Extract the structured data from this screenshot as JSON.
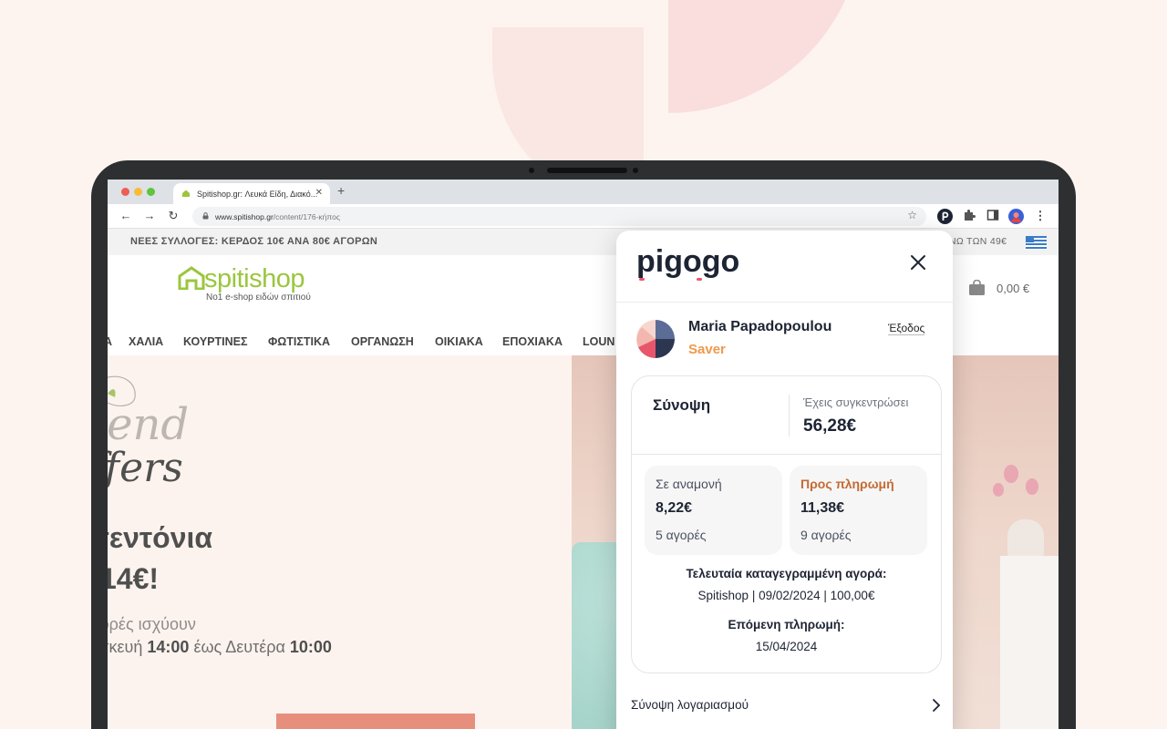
{
  "browser": {
    "tab_title": "Spitishop.gr: Λευκά Είδη, Διακό...",
    "url_domain": "www.spitishop.gr",
    "url_path": "/content/176-κήπος"
  },
  "site": {
    "promo_left": "ΝΕΕΣ ΣΥΛΛΟΓΕΣ: ΚΕΡΔΟΣ 10€ ΑΝΑ 80€ ΑΓΟΡΩΝ",
    "promo_right": "ΝΩ ΤΩΝ 49€",
    "logo_name": "spitishop",
    "logo_tagline": "No1 e-shop ειδών σπιτιού",
    "cart_total": "0,00 €",
    "menu": [
      "Α",
      "ΧΑΛΙΑ",
      "ΚΟΥΡΤΙΝΕΣ",
      "ΦΩΤΙΣΤΙΚΑ",
      "ΟΡΓΑΝΩΣΗ",
      "ΟΙΚΙΑΚΑ",
      "ΕΠΟΧΙΑΚΑ",
      "LOUN"
    ],
    "hero": {
      "script_top": "kend",
      "script_bottom": "ffers",
      "headline_1": "σεντόνια",
      "headline_2": "14€!",
      "line_1": "φορές ισχύουν",
      "line_2_prefix": "ασκευή ",
      "line_2_time1": "14:00",
      "line_2_mid": " έως Δευτέρα ",
      "line_2_time2": "10:00"
    }
  },
  "popup": {
    "brand": "pigogo",
    "user": {
      "name": "Maria Papadopoulou",
      "tier": "Saver"
    },
    "logout_label": "Έξοδος",
    "summary": {
      "title": "Σύνοψη",
      "collected_label": "Έχεις συγκεντρώσει",
      "collected_value": "56,28€",
      "pending": {
        "label": "Σε αναμονή",
        "value": "8,22€",
        "count": "5 αγορές"
      },
      "to_pay": {
        "label": "Προς πληρωμή",
        "value": "11,38€",
        "count": "9 αγορές"
      },
      "last_purchase_label": "Τελευταία καταγεγραμμένη αγορά:",
      "last_purchase_value": "Spitishop | 09/02/2024 | 100,00€",
      "next_payment_label": "Επόμενη πληρωμή:",
      "next_payment_value": "15/04/2024"
    },
    "account_summary_link": "Σύνοψη λογαριασμού"
  },
  "colors": {
    "accent_orange": "#f0994b",
    "to_pay_label": "#c56a32",
    "brand_pink": "#e8566c",
    "brand_dark": "#1d2433",
    "logo_green": "#9bc63e"
  }
}
